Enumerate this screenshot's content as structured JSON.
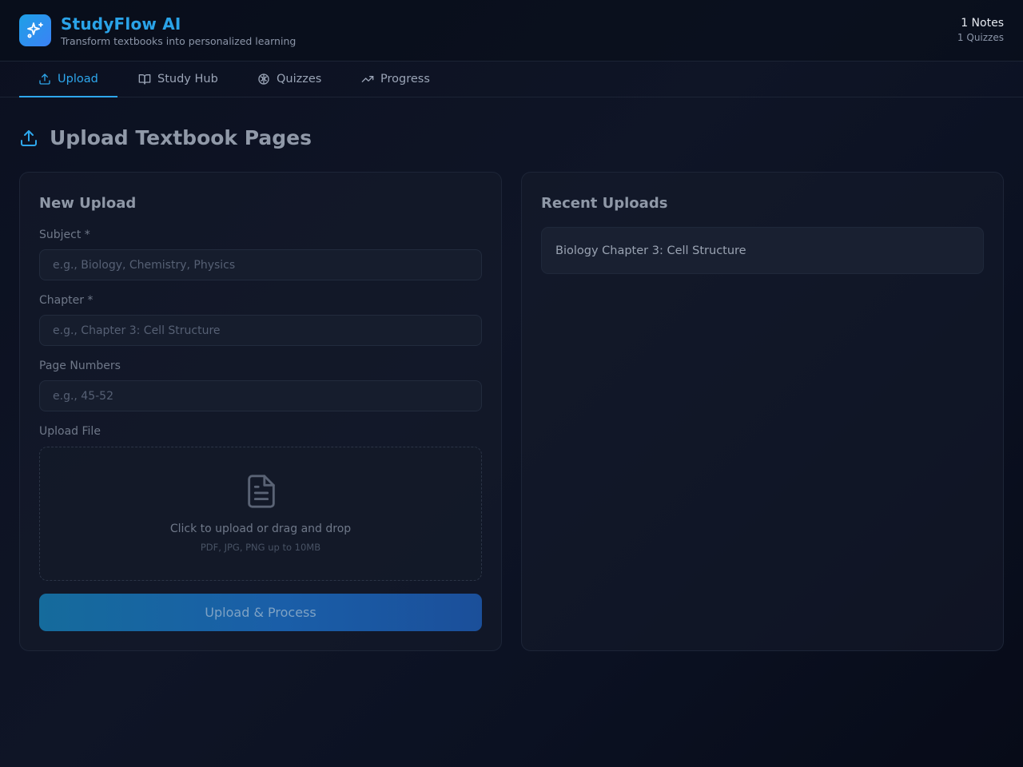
{
  "app": {
    "title": "StudyFlow AI",
    "subtitle": "Transform textbooks into personalized learning",
    "logo_icon": "sparkles-icon",
    "accent_color": "#2aa3e8"
  },
  "stats": {
    "notes": "1 Notes",
    "quizzes": "1 Quizzes"
  },
  "tabs": [
    {
      "label": "Upload",
      "icon": "upload-icon",
      "active": true
    },
    {
      "label": "Study Hub",
      "icon": "book-open-icon",
      "active": false
    },
    {
      "label": "Quizzes",
      "icon": "brain-icon",
      "active": false
    },
    {
      "label": "Progress",
      "icon": "trending-up-icon",
      "active": false
    }
  ],
  "section": {
    "title": "Upload Textbook Pages",
    "icon": "upload-icon"
  },
  "new_upload": {
    "title": "New Upload",
    "subject": {
      "label": "Subject *",
      "placeholder": "e.g., Biology, Chemistry, Physics",
      "value": ""
    },
    "chapter": {
      "label": "Chapter *",
      "placeholder": "e.g., Chapter 3: Cell Structure",
      "value": ""
    },
    "pages": {
      "label": "Page Numbers",
      "placeholder": "e.g., 45-52",
      "value": ""
    },
    "file": {
      "label": "Upload File",
      "prompt": "Click to upload or drag and drop",
      "hint": "PDF, JPG, PNG up to 10MB",
      "icon": "file-text-icon"
    },
    "submit_label": "Upload & Process"
  },
  "recent": {
    "title": "Recent Uploads",
    "items": [
      {
        "label": "Biology Chapter 3: Cell Structure"
      }
    ]
  }
}
